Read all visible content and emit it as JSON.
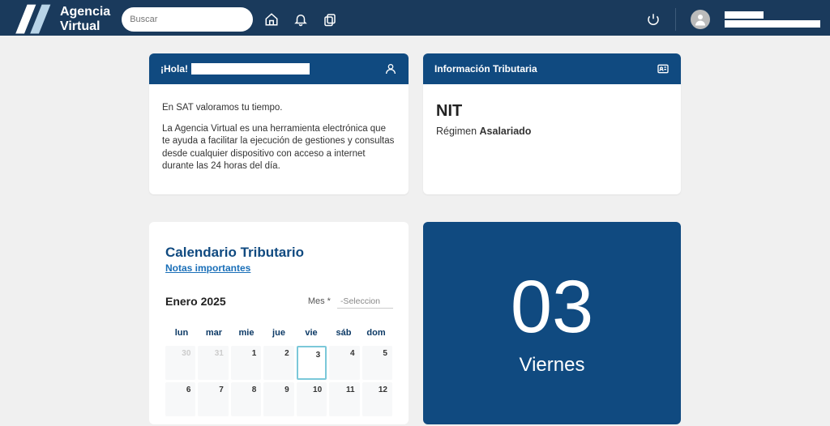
{
  "topbar": {
    "appName": "Agencia Virtual",
    "searchPlaceholder": "Buscar"
  },
  "hola": {
    "greeting": "¡Hola!",
    "p1": "En SAT valoramos tu tiempo.",
    "p2": "La Agencia Virtual es una herramienta electrónica que te ayuda a facilitar la ejecución de gestiones y consultas desde cualquier dispositivo con acceso a internet durante las 24 horas del día."
  },
  "info": {
    "header": "Información Tributaria",
    "nitLabel": "NIT",
    "regimenLabel": "Régimen",
    "regimenValue": "Asalariado"
  },
  "calendar": {
    "title": "Calendario Tributario",
    "link": "Notas importantes",
    "month": "Enero 2025",
    "mesLabel": "Mes *",
    "selectPlaceholder": "-Seleccion",
    "dow": [
      "lun",
      "mar",
      "mie",
      "jue",
      "vie",
      "sáb",
      "dom"
    ],
    "cells": [
      {
        "n": "30",
        "muted": true
      },
      {
        "n": "31",
        "muted": true
      },
      {
        "n": "1"
      },
      {
        "n": "2"
      },
      {
        "n": "3",
        "selected": true
      },
      {
        "n": "4"
      },
      {
        "n": "5"
      },
      {
        "n": "6"
      },
      {
        "n": "7"
      },
      {
        "n": "8"
      },
      {
        "n": "9"
      },
      {
        "n": "10"
      },
      {
        "n": "11"
      },
      {
        "n": "12"
      }
    ]
  },
  "dayCard": {
    "num": "03",
    "name": "Viernes"
  }
}
